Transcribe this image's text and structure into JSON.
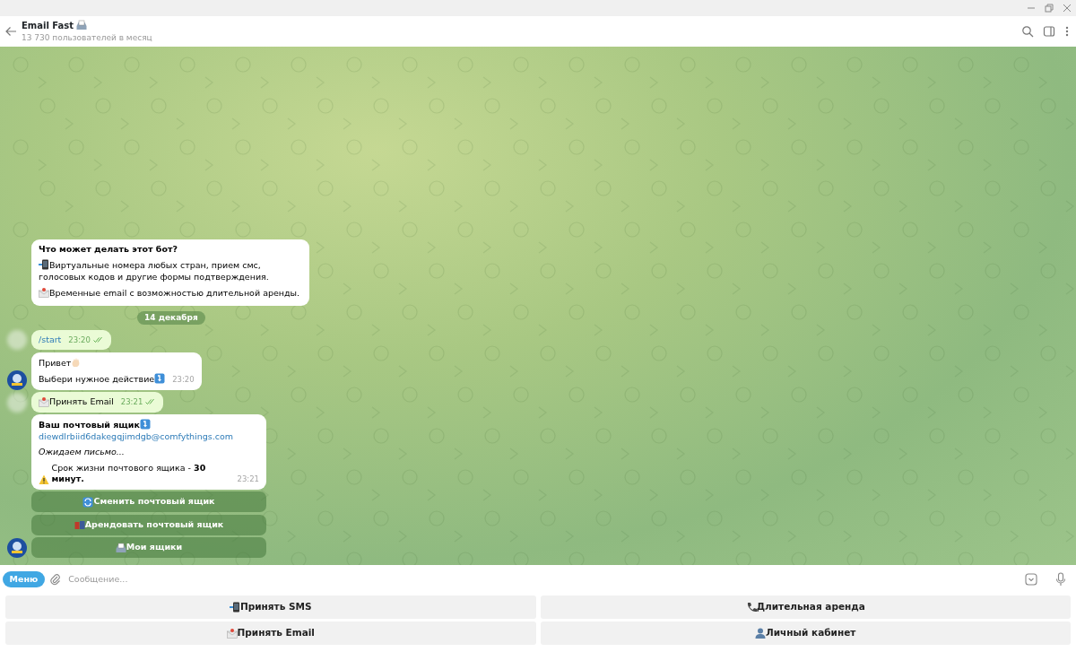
{
  "chat": {
    "title": "Email Fast",
    "subtitle": "13 730 пользователей в месяц"
  },
  "intro": {
    "title": "Что может делать этот бот?",
    "paragraphs": [
      "Виртуальные номера любых стран, прием смс, голосовых кодов и другие формы подтверждения.",
      "Временные email с возможностью длительной аренды."
    ]
  },
  "date": "14 декабря",
  "messages": [
    {
      "kind": "outgoing",
      "text": "/start",
      "command": true,
      "time": "23:20",
      "read": true
    },
    {
      "kind": "incoming",
      "paragraphs": [
        "Привет",
        "Выбери нужное действие"
      ],
      "time": "23:20",
      "avatar": true
    },
    {
      "kind": "outgoing",
      "text": "Принять Email",
      "command": false,
      "time": "23:21",
      "read": true
    },
    {
      "kind": "mailbox",
      "title": "Ваш почтовый ящик",
      "email": "diewdlrbiid6dakegqjimdgb@comfythings.com",
      "status": "Ожидаем письмо...",
      "notice": "Срок жизни почтового ящика - **30 минут.**",
      "time": "23:21",
      "buttons": [
        "Сменить почтовый ящик",
        "Арендовать почтовый ящик",
        "Мои ящики"
      ],
      "avatar": true
    }
  ],
  "composer": {
    "menu": "Меню",
    "placeholder": "Сообщение..."
  },
  "keyboard": [
    [
      "Принять SMS",
      "Длительная аренда"
    ],
    [
      "Принять Email",
      "Личный кабинет"
    ]
  ]
}
